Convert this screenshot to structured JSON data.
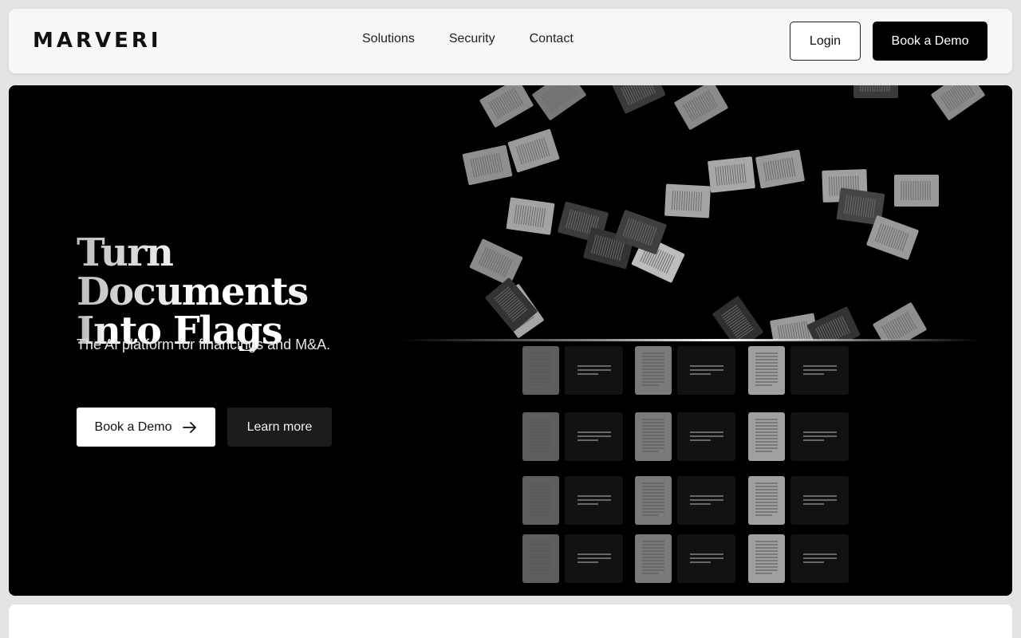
{
  "header": {
    "brand": "MARVERI",
    "links": [
      {
        "label": "Solutions"
      },
      {
        "label": "Security"
      },
      {
        "label": "Contact"
      }
    ],
    "login_label": "Login",
    "demo_label": "Book a Demo"
  },
  "hero": {
    "title_line1": "Turn Documents",
    "title_line2": "Into Flags",
    "subtitle": "The AI platform for financings and M&A.",
    "primary_cta": "Book a Demo",
    "primary_cta_icon": "arrow-right-icon",
    "secondary_cta": "Learn more"
  },
  "colors": {
    "background": "#e4e4e4",
    "nav_background": "#f7f7f7",
    "hero_background": "#000000",
    "primary_button": "#000000",
    "secondary_button": "#1c1c1c"
  }
}
